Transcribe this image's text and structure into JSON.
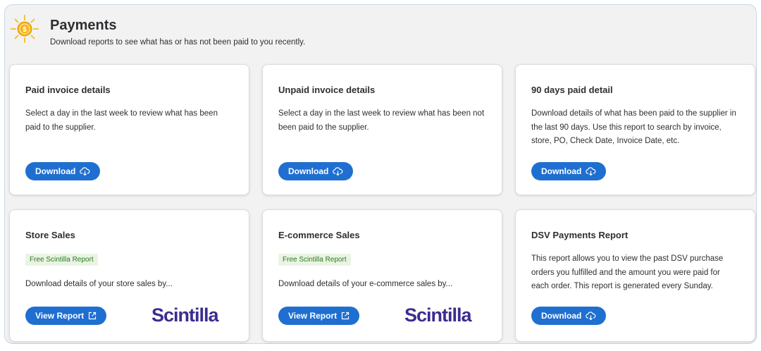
{
  "header": {
    "title": "Payments",
    "subtitle": "Download reports to see what has or has not been paid to you recently.",
    "icon": "sun-dollar-icon"
  },
  "colors": {
    "accent": "#1f6fd1",
    "badge_bg": "#eaf4e3",
    "badge_text": "#2a7a22",
    "brand": "#3a2d8f"
  },
  "cards": [
    {
      "title": "Paid invoice details",
      "description": "Select a day in the last week to review what has been paid to the supplier.",
      "button": "Download"
    },
    {
      "title": "Unpaid invoice details",
      "description": "Select a day in the last week to review what has been not been paid to the supplier.",
      "button": "Download"
    },
    {
      "title": "90 days paid detail",
      "description": "Download details of what has been paid to the supplier in the last 90 days. Use this report to search by invoice, store, PO, Check Date, Invoice Date, etc.",
      "button": "Download"
    },
    {
      "title": "Store Sales",
      "badge": "Free Scintilla Report",
      "description": "Download details of your store sales by...",
      "button": "View Report",
      "brand": "Scintilla"
    },
    {
      "title": "E-commerce Sales",
      "badge": "Free Scintilla Report",
      "description": "Download details of your e-commerce sales by...",
      "button": "View Report",
      "brand": "Scintilla"
    },
    {
      "title": "DSV Payments Report",
      "description": "This report allows you to view the past DSV purchase orders you fulfilled and the amount you were paid for each order. This report is generated every Sunday.",
      "button": "Download"
    }
  ]
}
